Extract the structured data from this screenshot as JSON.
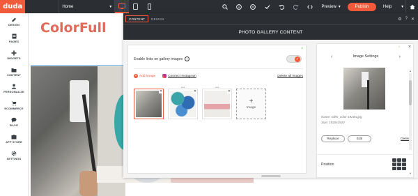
{
  "app": {
    "logo_text": "duda",
    "brand_accent": "#f15a3b",
    "toolbar_bg": "#2b2f33"
  },
  "toolbar": {
    "page_select": "Home",
    "devices": [
      {
        "icon": "desktop-icon",
        "active": true
      },
      {
        "icon": "tablet-icon",
        "active": false
      },
      {
        "icon": "mobile-icon",
        "active": false
      }
    ],
    "tools": [
      {
        "icon": "search-icon"
      },
      {
        "icon": "info-icon"
      },
      {
        "icon": "zoom-out-icon"
      },
      {
        "icon": "check-icon"
      },
      {
        "icon": "undo-icon"
      },
      {
        "icon": "redo-icon"
      },
      {
        "icon": "code-icon"
      }
    ],
    "preview_label": "Preview",
    "publish_label": "Publish",
    "help_label": "Help"
  },
  "sidebar": {
    "items": [
      {
        "label": "DESIGN",
        "icon": "palette-icon"
      },
      {
        "label": "PAGES",
        "icon": "pages-icon"
      },
      {
        "label": "WIDGETS",
        "icon": "plus-icon"
      },
      {
        "label": "CONTENT",
        "icon": "folder-icon"
      },
      {
        "label": "PERSONALIZE",
        "icon": "person-icon"
      },
      {
        "label": "ECOMMERCE",
        "icon": "cart-icon"
      },
      {
        "label": "BLOG",
        "icon": "chat-icon"
      },
      {
        "label": "APP STORE",
        "icon": "puzzle-icon"
      },
      {
        "label": "SETTINGS",
        "icon": "gear-icon"
      }
    ]
  },
  "site": {
    "brand_name": "ColorFull",
    "brand_color": "#e06a5a"
  },
  "panel": {
    "tabs": [
      {
        "label": "CONTENT",
        "active": true
      },
      {
        "label": "DESIGN",
        "active": false
      }
    ],
    "title": "PHOTO GALLERY CONTENT",
    "enable_links_label": "Enable links on gallery images",
    "enable_links_on": true,
    "add_image_label": "Add Image",
    "connect_instagram_label": "Connect Instagram",
    "delete_all_label": "Delete all images",
    "thumbnails": [
      {
        "name": "roller",
        "selected": true
      },
      {
        "name": "paint-cans",
        "selected": false
      },
      {
        "name": "pink-sofa",
        "selected": false
      }
    ],
    "add_tile_label": "Image"
  },
  "image_settings": {
    "title": "Image Settings",
    "name_line": "Name: roller_color-1920w.jpg",
    "size_line": "Size: 1920x1920",
    "replace_label": "Replace",
    "edit_label": "Edit",
    "delete_label": "Delete",
    "position_label": "Position"
  }
}
